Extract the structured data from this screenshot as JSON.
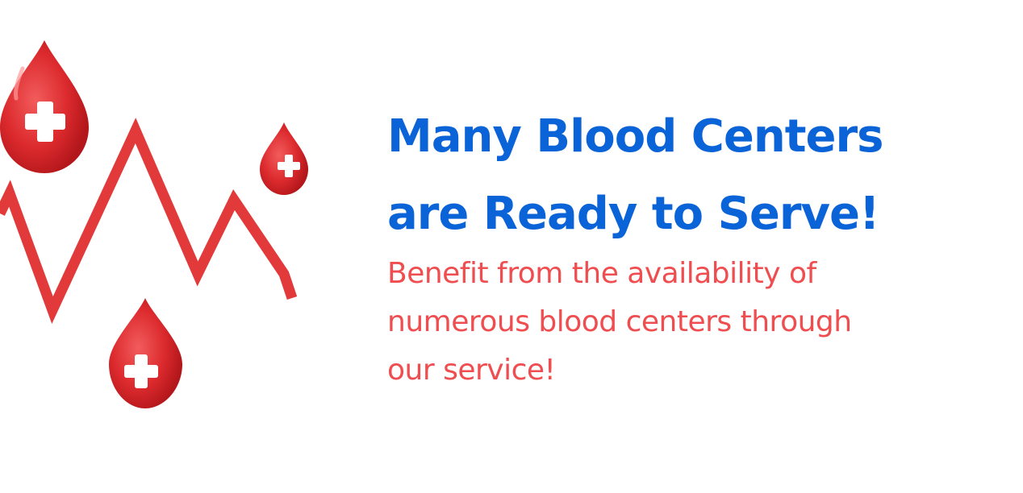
{
  "colors": {
    "headline": "#0b63d8",
    "subtitle": "#ef4d4f",
    "drop_red": "#d8282c",
    "pulse_red": "#e23a3a",
    "cross_white": "#ffffff"
  },
  "illustration": {
    "icons": [
      "blood-drop-cross-icon",
      "blood-drop-cross-icon",
      "blood-drop-cross-icon",
      "heartbeat-line-icon"
    ]
  },
  "headline": {
    "line1": "Many Blood Centers",
    "line2": "are Ready to Serve!"
  },
  "subtitle": {
    "line1": "Benefit from the availability of",
    "line2": "numerous blood centers through",
    "line3": "our service!"
  }
}
